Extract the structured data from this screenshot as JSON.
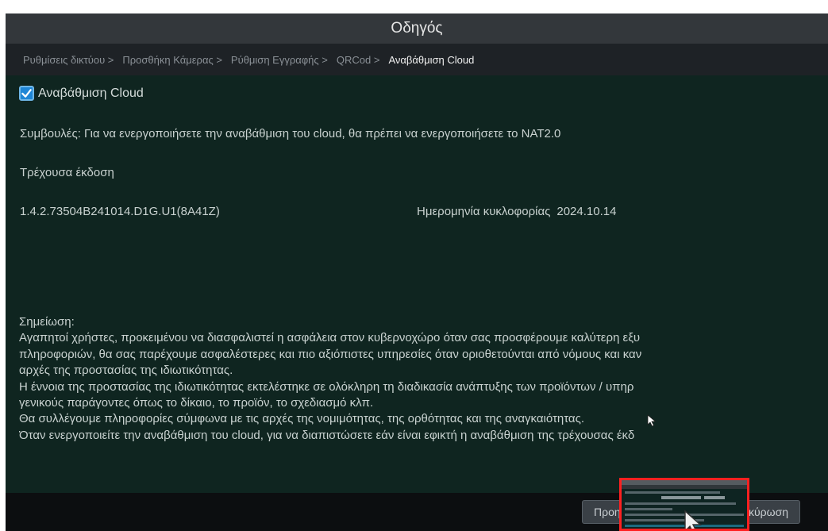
{
  "window": {
    "title": "Οδηγός"
  },
  "breadcrumb": [
    {
      "label": "Ρυθμίσεις δικτύου >",
      "active": false
    },
    {
      "label": "Προσθήκη Κάμερας >",
      "active": false
    },
    {
      "label": "Ρύθμιση Εγγραφής >",
      "active": false
    },
    {
      "label": "QRCod >",
      "active": false
    },
    {
      "label": "Αναβάθμιση Cloud",
      "active": true
    }
  ],
  "cloud_upgrade": {
    "checkbox_label": "Αναβάθμιση Cloud",
    "checked": true
  },
  "tips": "Συμβουλές: Για να ενεργοποιήσετε την αναβάθμιση του cloud, θα πρέπει να ενεργοποιήσετε το NAT2.0",
  "current_version_label": "Τρέχουσα έκδοση",
  "version": "1.4.2.73504B241014.D1G.U1(8A41Z)",
  "release_date_label": "Ημερομηνία κυκλοφορίας",
  "release_date": "2024.10.14",
  "note": {
    "title": "Σημείωση:",
    "lines": [
      "Αγαπητοί χρήστες, προκειμένου να διασφαλιστεί η ασφάλεια στον κυβερνοχώρο όταν σας προσφέρουμε καλύτερη εξυ",
      "πληροφοριών, θα σας παρέχουμε ασφαλέστερες και πιο αξιόπιστες υπηρεσίες όταν οριοθετούνται από νόμους και καν",
      "αρχές της προστασίας της ιδιωτικότητας.",
      " Η έννοια της προστασίας της ιδιωτικότητας εκτελέστηκε σε ολόκληρη τη διαδικασία ανάπτυξης των προϊόντων / υπηρ",
      "γενικούς παράγοντες όπως το δίκαιο, το προϊόν, το σχεδιασμό κλπ.",
      " Θα συλλέγουμε πληροφορίες σύμφωνα με τις αρχές της νομιμότητας, της ορθότητας και της αναγκαιότητας.",
      " Όταν ενεργοποιείτε την αναβάθμιση του cloud, για να διαπιστώσετε εάν είναι εφικτή η αναβάθμιση της τρέχουσας έκδ"
    ]
  },
  "footer": {
    "prev_label": "Προη",
    "cancel_label": "κύρωση"
  },
  "colors": {
    "content_bg": "#0f2520",
    "titlebar_bg": "#33373b",
    "checkbox_accent": "#1f86d6",
    "highlight_border": "#ff2020"
  },
  "icons": [
    "checkmark-icon",
    "mouse-cursor-icon"
  ]
}
